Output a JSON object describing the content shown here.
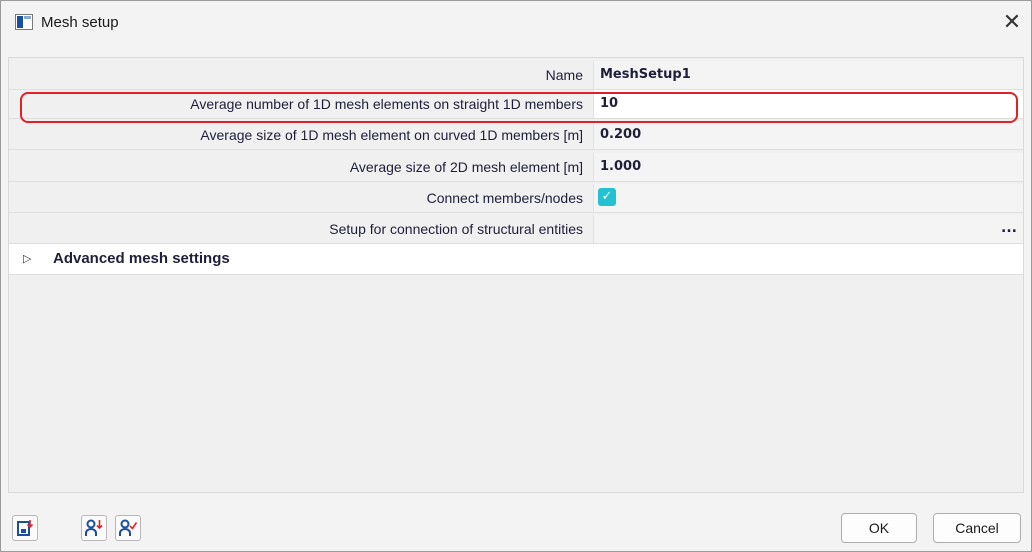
{
  "window": {
    "title": "Mesh setup",
    "icon": "window-app-icon",
    "close": "close-icon"
  },
  "properties": {
    "rows": [
      {
        "label": "Name",
        "value": "MeshSetup1"
      },
      {
        "label": "Average number of 1D mesh elements on straight 1D members",
        "value": "10"
      },
      {
        "label": "Average size of 1D mesh element on curved 1D members [m]",
        "value": "0.200"
      },
      {
        "label": "Average size of 2D mesh element [m]",
        "value": "1.000"
      },
      {
        "label": "Connect members/nodes",
        "checked": true
      },
      {
        "label": "Setup for connection of structural entities",
        "value": "",
        "action": "..."
      }
    ],
    "advanced": {
      "toggle": "▷",
      "label": "Advanced mesh settings"
    }
  },
  "colors": {
    "highlight_outline": "#e0212a",
    "checkbox": "#23c1d1",
    "icon_blue": "#1a4fa0"
  },
  "footer": {
    "tool_icons": [
      "save-default-icon",
      "user-down-icon",
      "user-check-icon"
    ],
    "ok_label": "OK",
    "cancel_label": "Cancel"
  }
}
